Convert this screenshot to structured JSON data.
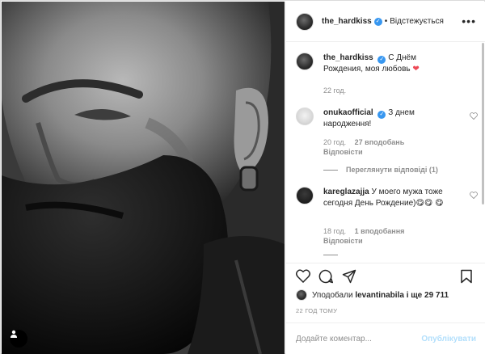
{
  "header": {
    "username": "the_hardkiss",
    "verified_icon": "verified-badge-icon",
    "separator": "•",
    "follow_state": "Відстежується",
    "more_icon": "more-options-icon"
  },
  "caption": {
    "username": "the_hardkiss",
    "text": "С Днём Рождения, моя любовь",
    "emoji": "❤",
    "time": "22 год."
  },
  "comments": [
    {
      "username": "onukaofficial",
      "verified": true,
      "text": "З днем народження!",
      "time": "20 год.",
      "likes": "27 вподобань",
      "reply_label": "Відповісти",
      "view_replies": "Переглянути відповіді (1)"
    },
    {
      "username": "kareglazajja",
      "verified": false,
      "text": "У моего мужа тоже сегодня День Рождение)",
      "emoji": "😋😋 😋",
      "time": "18 год.",
      "likes": "1 вподобання",
      "reply_label": "Відповісти"
    }
  ],
  "actions": {
    "like_icon": "heart-icon",
    "comment_icon": "comment-bubble-icon",
    "share_icon": "paper-plane-icon",
    "save_icon": "bookmark-icon"
  },
  "likes_summary": {
    "prefix": "Уподобали",
    "user": "levantinabila",
    "suffix": "і ще 29 711"
  },
  "timeago": "22 ГОД ТОМУ",
  "add_comment": {
    "placeholder": "Додайте коментар...",
    "post_label": "Опублікувати"
  },
  "colors": {
    "verified": "#3897f0",
    "heart": "#ed4956",
    "post_disabled": "#b2dffc",
    "muted": "#8e8e8e"
  }
}
